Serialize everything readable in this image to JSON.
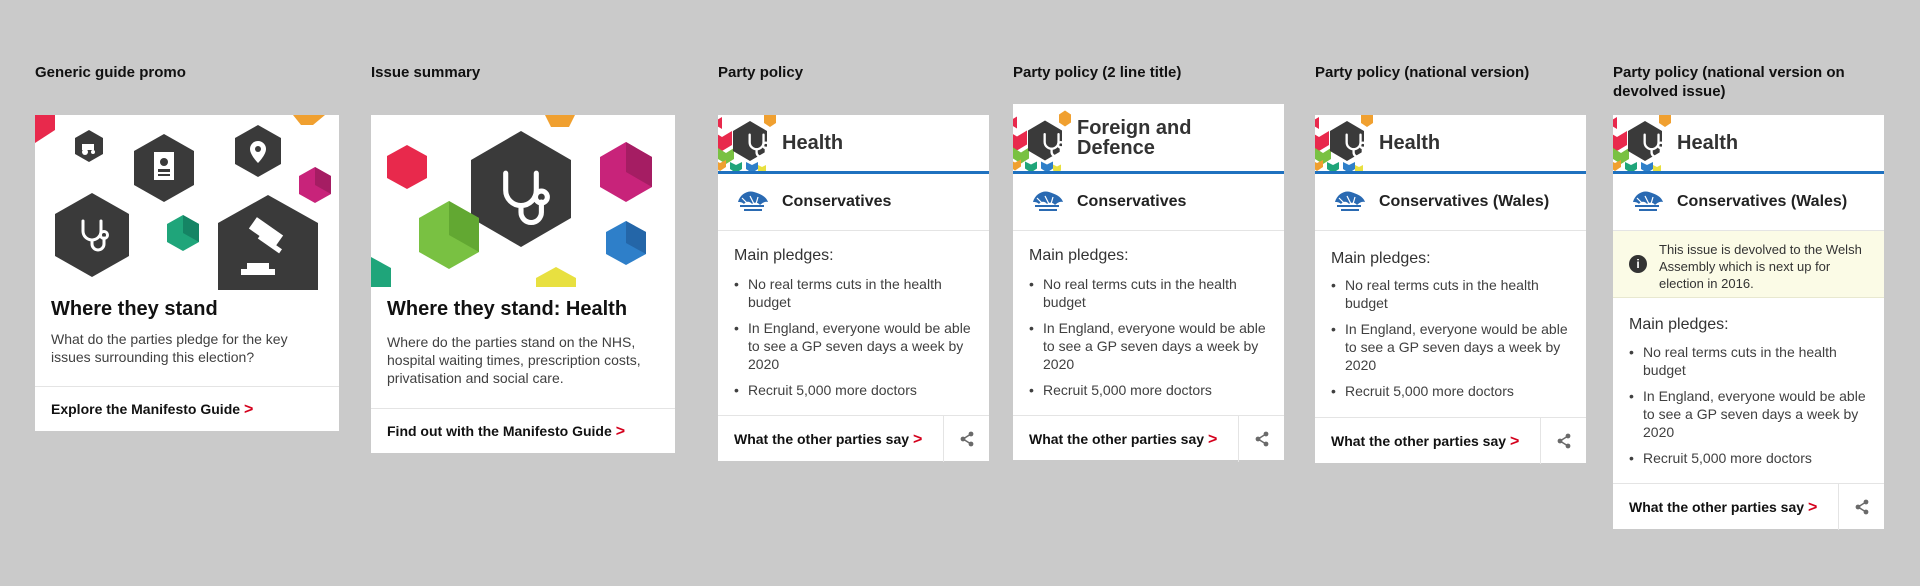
{
  "columns": [
    {
      "title": "Generic guide promo"
    },
    {
      "title": "Issue summary"
    },
    {
      "title": "Party policy"
    },
    {
      "title": "Party policy (2 line title)"
    },
    {
      "title": "Party policy (national version)"
    },
    {
      "title": "Party policy (national version on devolved issue)"
    }
  ],
  "promo": {
    "title": "Where they stand",
    "description": "What do the parties pledge for the key issues surrounding this election?",
    "link": "Explore the Manifesto Guide",
    "chevron": ">"
  },
  "issue_summary": {
    "title": "Where they stand: Health",
    "description": "Where do the parties stand on the NHS, hospital waiting times, prescription costs, privatisation and social care.",
    "link": "Find out with the Manifesto Guide",
    "chevron": ">"
  },
  "policy_cards": [
    {
      "issue": "Health",
      "party": "Conservatives"
    },
    {
      "issue": "Foreign and Defence",
      "party": "Conservatives"
    },
    {
      "issue": "Health",
      "party": "Conservatives (Wales)"
    },
    {
      "issue": "Health",
      "party": "Conservatives (Wales)",
      "notice": "This issue is devolved to the Welsh Assembly which is next up for election in 2016."
    }
  ],
  "pledges": {
    "heading": "Main pledges:",
    "items": [
      "No real terms cuts in the health budget",
      "In England, everyone would be able to see a GP seven days a week by 2020",
      "Recruit 5,000 more doctors"
    ]
  },
  "footer": {
    "link": "What the other parties say",
    "chevron": ">"
  },
  "notice_icon": "i",
  "colors": {
    "background": "#cacaca",
    "accent_blue": "#1f71bf",
    "chevron_red": "#d4001c",
    "hex_dark": "#3a3a3a",
    "notice_bg": "#fbfbe6"
  }
}
